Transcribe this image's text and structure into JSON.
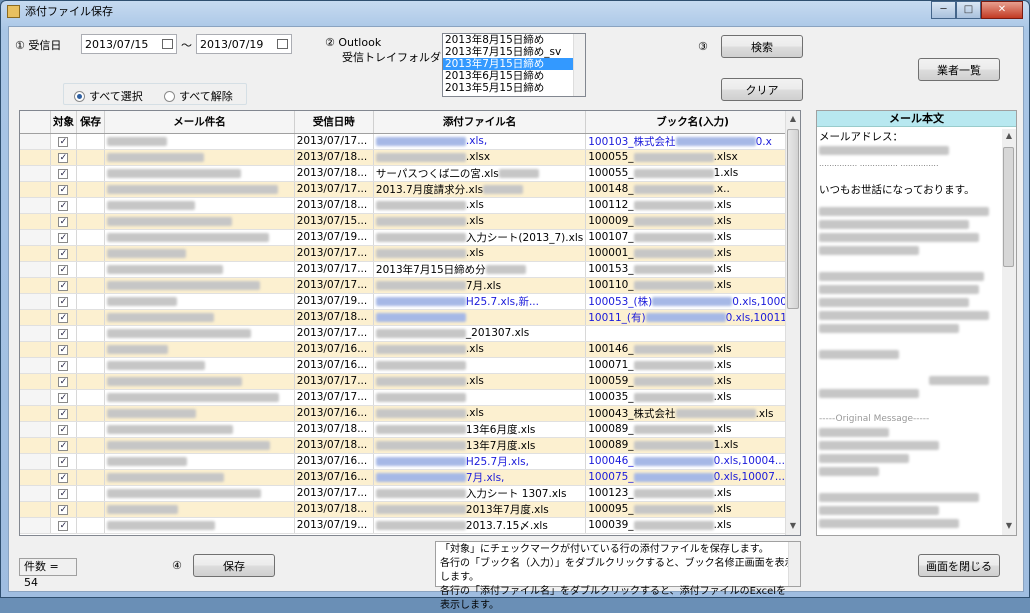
{
  "window": {
    "title": "添付ファイル保存",
    "min": "─",
    "max": "□",
    "close": "✕"
  },
  "filters": {
    "step1": "① 受信日",
    "from": "2013/07/15",
    "tilde": "～",
    "to": "2013/07/19",
    "step2_line1": "② Outlook",
    "step2_line2": "受信トレイフォルダ",
    "step3": "③",
    "step4": "④"
  },
  "folders": [
    "2013年8月15日締め",
    "2013年7月15日締め_sv",
    "2013年7月15日締め",
    "2013年6月15日締め",
    "2013年5月15日締め"
  ],
  "buttons": {
    "search": "検索",
    "clear": "クリア",
    "vendors": "業者一覧",
    "save": "保存",
    "close_screen": "画面を閉じる"
  },
  "radios": {
    "select_all": "すべて選択",
    "deselect_all": "すべて解除"
  },
  "grid": {
    "headers": [
      "対象",
      "保存",
      "メール件名",
      "受信日時",
      "添付ファイル名",
      "ブック名(入力)"
    ],
    "rows": [
      {
        "date": "2013/07/17...",
        "att_pre": "",
        "att": ".xls,",
        "att_link": true,
        "book_pre": "100103_株式会社",
        "book": "0.x",
        "book_link": true,
        "alt": false
      },
      {
        "date": "2013/07/18...",
        "att_pre": "",
        "att": ".xlsx",
        "att_link": false,
        "book_pre": "100055_",
        "book": ".xlsx",
        "book_link": false,
        "alt": true
      },
      {
        "date": "2013/07/18...",
        "att_pre": "サーパスつくば二の宮.xls",
        "att": "",
        "att_link": false,
        "book_pre": "100055_",
        "book": "1.xls",
        "book_link": false,
        "alt": false
      },
      {
        "date": "2013/07/17...",
        "att_pre": "2013.7月度請求分.xls",
        "att": "",
        "att_link": false,
        "book_pre": "100148_",
        "book": ".x..",
        "book_link": false,
        "alt": true
      },
      {
        "date": "2013/07/18...",
        "att_pre": "",
        "att": ".xls",
        "att_link": false,
        "book_pre": "100112_",
        "book": ".xls",
        "book_link": false,
        "alt": false
      },
      {
        "date": "2013/07/15...",
        "att_pre": "",
        "att": ".xls",
        "att_link": false,
        "book_pre": "100009_",
        "book": ".xls",
        "book_link": false,
        "alt": true
      },
      {
        "date": "2013/07/19...",
        "att_pre": "",
        "att": "入力シート(2013_7).xls",
        "att_link": false,
        "book_pre": "100107_",
        "book": ".xls",
        "book_link": false,
        "alt": false
      },
      {
        "date": "2013/07/17...",
        "att_pre": "",
        "att": ".xls",
        "att_link": false,
        "book_pre": "100001_",
        "book": ".xls",
        "book_link": false,
        "alt": true
      },
      {
        "date": "2013/07/17...",
        "att_pre": "2013年7月15日締め分",
        "att": "",
        "att_link": false,
        "book_pre": "100153_",
        "book": ".xls",
        "book_link": false,
        "alt": false
      },
      {
        "date": "2013/07/17...",
        "att_pre": "",
        "att": "7月.xls",
        "att_link": false,
        "book_pre": "100110_",
        "book": ".xls",
        "book_link": false,
        "alt": true
      },
      {
        "date": "2013/07/19...",
        "att_pre": "",
        "att": "H25.7.xls,新...",
        "att_link": true,
        "book_pre": "100053_(株)",
        "book": "0.xls,1000...",
        "book_link": true,
        "alt": false
      },
      {
        "date": "2013/07/18...",
        "att_pre": "",
        "att": "",
        "att_link": true,
        "book_pre": "10011_(有)",
        "book": "0.xls,10011...",
        "book_link": true,
        "alt": true
      },
      {
        "date": "2013/07/17...",
        "att_pre": "",
        "att": "_201307.xls",
        "att_link": false,
        "book_pre": "",
        "book": "",
        "book_link": false,
        "alt": false
      },
      {
        "date": "2013/07/16...",
        "att_pre": "",
        "att": ".xls",
        "att_link": false,
        "book_pre": "100146_",
        "book": ".xls",
        "book_link": false,
        "alt": true
      },
      {
        "date": "2013/07/16...",
        "att_pre": "",
        "att": "",
        "att_link": false,
        "book_pre": "100071_",
        "book": ".xls",
        "book_link": false,
        "alt": false
      },
      {
        "date": "2013/07/17...",
        "att_pre": "",
        "att": ".xls",
        "att_link": false,
        "book_pre": "100059_",
        "book": ".xls",
        "book_link": false,
        "alt": true
      },
      {
        "date": "2013/07/17...",
        "att_pre": "",
        "att": "",
        "att_link": false,
        "book_pre": "100035_",
        "book": ".xls",
        "book_link": false,
        "alt": false
      },
      {
        "date": "2013/07/16...",
        "att_pre": "",
        "att": ".xls",
        "att_link": false,
        "book_pre": "100043_株式会社",
        "book": ".xls",
        "book_link": false,
        "alt": true
      },
      {
        "date": "2013/07/18...",
        "att_pre": "",
        "att": "13年6月度.xls",
        "att_link": false,
        "book_pre": "100089_",
        "book": ".xls",
        "book_link": false,
        "alt": false
      },
      {
        "date": "2013/07/18...",
        "att_pre": "",
        "att": "13年7月度.xls",
        "att_link": false,
        "book_pre": "100089_",
        "book": "1.xls",
        "book_link": false,
        "alt": true
      },
      {
        "date": "2013/07/16...",
        "att_pre": "",
        "att": "H25.7月.xls,",
        "att_link": true,
        "book_pre": "100046_",
        "book": "0.xls,10004...",
        "book_link": true,
        "alt": false
      },
      {
        "date": "2013/07/16...",
        "att_pre": "",
        "att": "7月.xls,",
        "att_link": true,
        "book_pre": "100075_",
        "book": "0.xls,10007...",
        "book_link": true,
        "alt": true
      },
      {
        "date": "2013/07/17...",
        "att_pre": "",
        "att": "入力シート 1307.xls",
        "att_link": false,
        "book_pre": "100123_",
        "book": ".xls",
        "book_link": false,
        "alt": false
      },
      {
        "date": "2013/07/18...",
        "att_pre": "",
        "att": "2013年7月度.xls",
        "att_link": false,
        "book_pre": "100095_",
        "book": ".xls",
        "book_link": false,
        "alt": true
      },
      {
        "date": "2013/07/19...",
        "att_pre": "",
        "att": "2013.7.15〆.xls",
        "att_link": false,
        "book_pre": "100039_",
        "book": ".xls",
        "book_link": false,
        "alt": false
      }
    ]
  },
  "mail": {
    "header": "メール本文",
    "address_label": "メールアドレス：",
    "dots": "...............  ...............  ...............",
    "greeting": "いつもお世話になっております。",
    "original": "-----Original Message-----"
  },
  "status": {
    "count": "件数 = 54"
  },
  "info": {
    "line1": "「対象」にチェックマークが付いている行の添付ファイルを保存します。",
    "line2": "各行の「ブック名（入力）」をダブルクリックすると、ブック名修正画面を表示します。",
    "line3": "各行の「添付ファイル名」をダブルクリックすると、添付ファイルのExcelを表示します。"
  }
}
